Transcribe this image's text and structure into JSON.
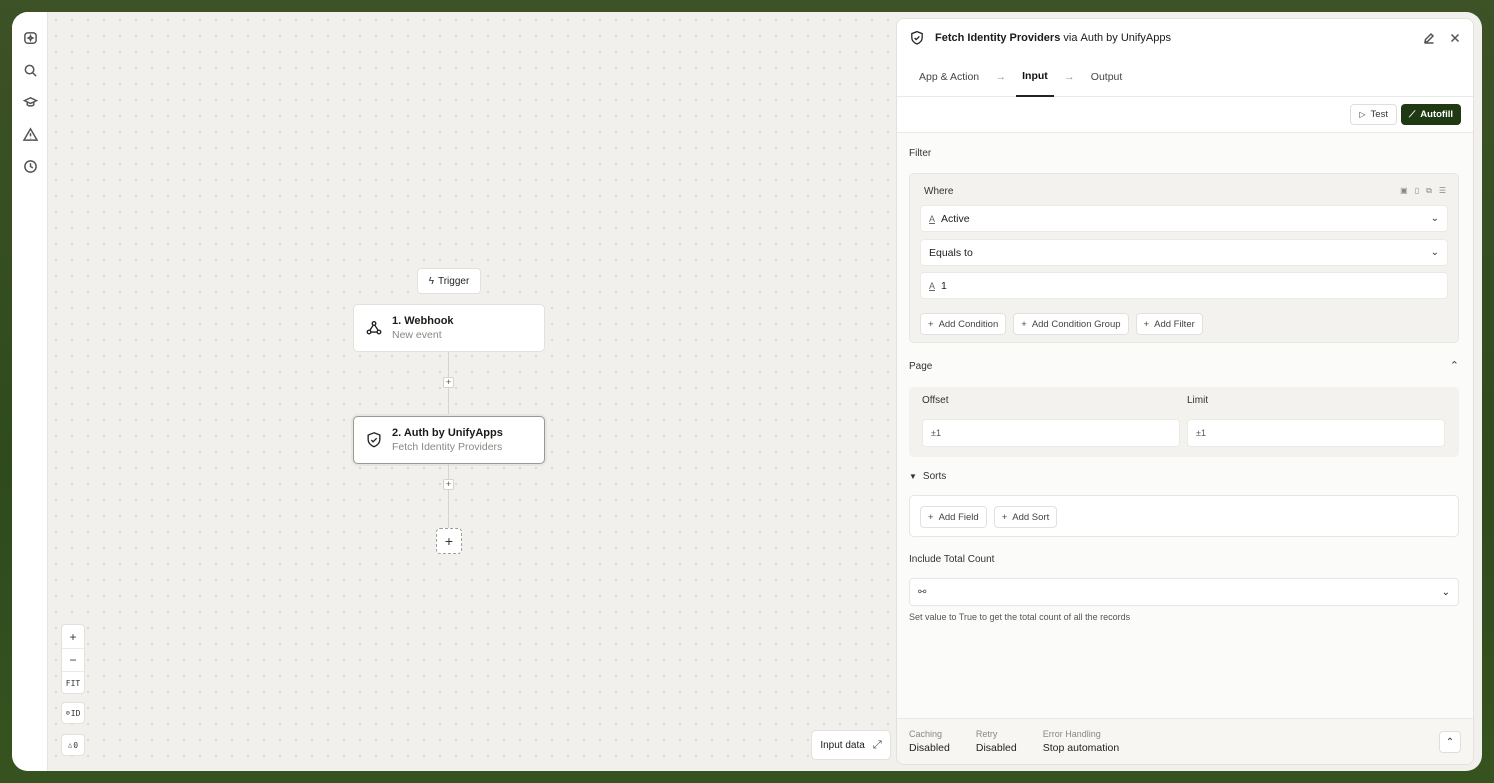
{
  "rail": {
    "items": [
      {
        "icon": "chat-sparkle-icon"
      },
      {
        "icon": "search-icon"
      },
      {
        "icon": "graduation-cap-icon"
      },
      {
        "icon": "warning-icon"
      },
      {
        "icon": "history-icon"
      }
    ]
  },
  "canvas": {
    "trigger_label": "Trigger",
    "nodes": [
      {
        "title": "1. Webhook",
        "subtitle": "New event",
        "icon": "webhook-icon"
      },
      {
        "title": "2. Auth by UnifyApps",
        "subtitle": "Fetch Identity Providers",
        "icon": "shield-check-icon"
      }
    ],
    "add_node_label": "+",
    "zoom_in": "+",
    "zoom_out": "−",
    "zoom_fit": "FIT",
    "id_toggle": "ID",
    "warnings_count": "0",
    "input_data_label": "Input data"
  },
  "panel": {
    "title_action": "Fetch Identity Providers",
    "title_via": "via",
    "title_app": "Auth by UnifyApps",
    "tabs": [
      "App & Action",
      "Input",
      "Output"
    ],
    "active_tab": "Input",
    "test_label": "Test",
    "autofill_label": "Autofill",
    "filter": {
      "section_label": "Filter",
      "where_label": "Where",
      "field_value": "Active",
      "operator_value": "Equals to",
      "compare_value": "1",
      "add_condition": "Add Condition",
      "add_condition_group": "Add Condition Group",
      "add_filter": "Add Filter"
    },
    "page": {
      "section_label": "Page",
      "offset_label": "Offset",
      "offset_placeholder": "±1",
      "limit_label": "Limit",
      "limit_placeholder": "±1"
    },
    "sorts": {
      "section_label": "Sorts",
      "add_field": "Add Field",
      "add_sort": "Add Sort"
    },
    "total_count": {
      "label": "Include Total Count",
      "hint": "Set value to True to get the total count of all the records"
    },
    "footer": {
      "caching_label": "Caching",
      "caching_value": "Disabled",
      "retry_label": "Retry",
      "retry_value": "Disabled",
      "error_label": "Error Handling",
      "error_value": "Stop automation"
    }
  },
  "colors": {
    "background_outer": "#34501f",
    "canvas": "#f1f0ec",
    "autofill_button": "#1f3a12"
  }
}
